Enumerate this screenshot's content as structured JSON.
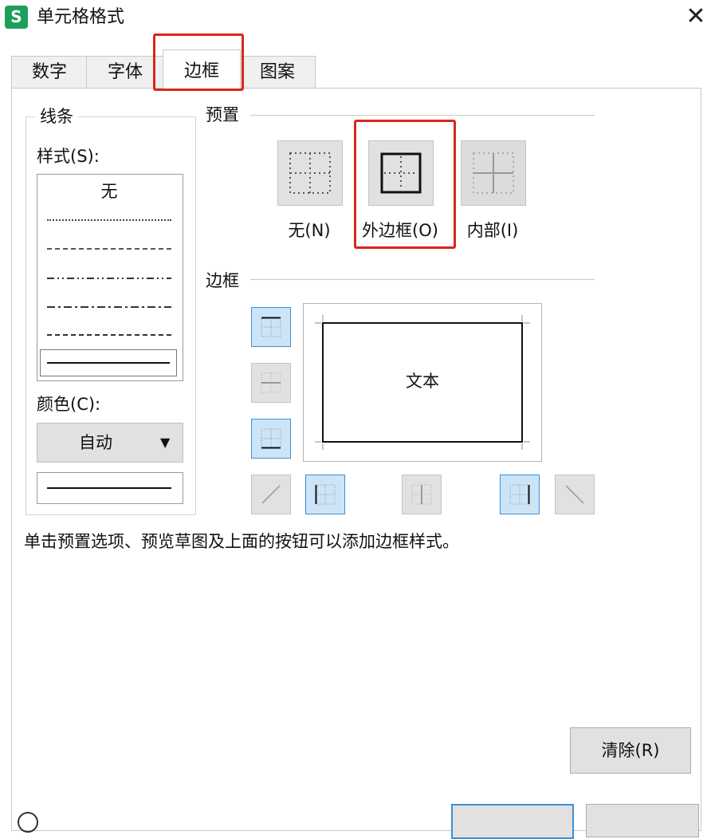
{
  "window": {
    "title": "单元格格式",
    "app_icon_letter": "S",
    "close_glyph": "✕"
  },
  "tabs": [
    {
      "label": "数字"
    },
    {
      "label": "字体"
    },
    {
      "label": "边框",
      "selected": true
    },
    {
      "label": "图案"
    }
  ],
  "line_group": {
    "legend": "线条",
    "style_label": "样式(S):",
    "styles": [
      {
        "label": "无"
      },
      {
        "name": "dotted-fine"
      },
      {
        "name": "dotted"
      },
      {
        "name": "dash-dot-dot"
      },
      {
        "name": "dash-dot"
      },
      {
        "name": "dashed"
      },
      {
        "name": "solid",
        "selected": true
      }
    ],
    "color_label": "颜色(C):",
    "color_value": "自动",
    "dropdown_glyph": "▼"
  },
  "presets": {
    "legend": "预置",
    "items": [
      {
        "label": "无(N)"
      },
      {
        "label": "外边框(O)",
        "highlighted": true
      },
      {
        "label": "内部(I)",
        "disabled": true
      }
    ]
  },
  "border_group": {
    "legend": "边框",
    "preview_text": "文本",
    "buttons": [
      {
        "name": "top",
        "state": "on"
      },
      {
        "name": "inner-horizontal",
        "state": "disabled"
      },
      {
        "name": "bottom",
        "state": "on"
      },
      {
        "name": "diagonal-up",
        "state": "disabled"
      },
      {
        "name": "left",
        "state": "on"
      },
      {
        "name": "inner-vertical",
        "state": "disabled"
      },
      {
        "name": "right",
        "state": "on"
      },
      {
        "name": "diagonal-down",
        "state": "disabled"
      }
    ]
  },
  "hint": "单击预置选项、预览草图及上面的按钮可以添加边框样式。",
  "buttons": {
    "clear": "清除(R)"
  },
  "colors": {
    "highlight_red": "#d9261c",
    "toggle_on_bg": "#cce4f7",
    "toggle_on_border": "#3c8fd6",
    "app_green": "#1e9e5a"
  }
}
